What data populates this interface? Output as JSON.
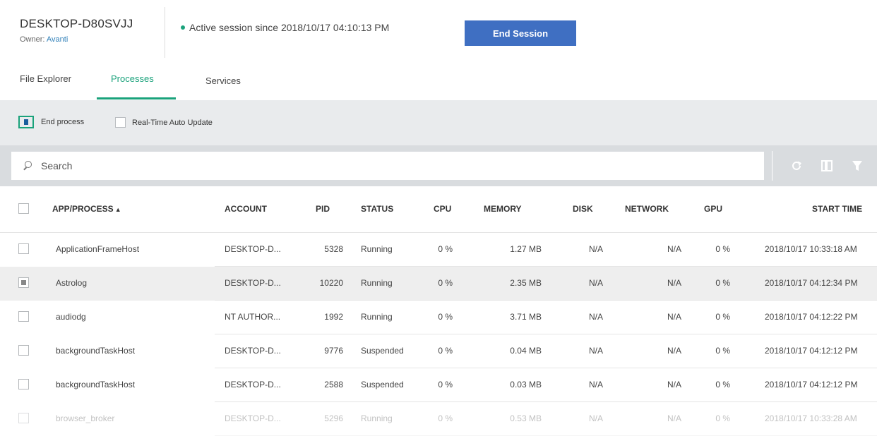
{
  "header": {
    "device_name": "DESKTOP-D80SVJJ",
    "owner_label": "Owner:",
    "owner_name": "Avanti",
    "session_text": "Active session since 2018/10/17 04:10:13 PM",
    "end_session_label": "End Session",
    "status_color": "#1aa27b",
    "accent_color": "#3f6fc2"
  },
  "tabs": [
    {
      "label": "File Explorer",
      "active": false
    },
    {
      "label": "Processes",
      "active": true
    },
    {
      "label": "Services",
      "active": false
    }
  ],
  "toolbar": {
    "end_process_label": "End process",
    "auto_update_label": "Real-Time Auto Update",
    "auto_update_checked": false
  },
  "search": {
    "placeholder": "Search",
    "icons": [
      "refresh-icon",
      "columns-icon",
      "filter-icon"
    ]
  },
  "table": {
    "columns": [
      "APP/PROCESS",
      "ACCOUNT",
      "PID",
      "STATUS",
      "CPU",
      "MEMORY",
      "DISK",
      "NETWORK",
      "GPU",
      "START TIME"
    ],
    "sort_indicator": "▲",
    "rows": [
      {
        "name": "ApplicationFrameHost",
        "account": "DESKTOP-D...",
        "pid": "5328",
        "status": "Running",
        "cpu": "0 %",
        "memory": "1.27 MB",
        "disk": "N/A",
        "network": "N/A",
        "gpu": "0 %",
        "start": "2018/10/17 10:33:18 AM",
        "selected": false
      },
      {
        "name": "Astrolog",
        "account": "DESKTOP-D...",
        "pid": "10220",
        "status": "Running",
        "cpu": "0 %",
        "memory": "2.35 MB",
        "disk": "N/A",
        "network": "N/A",
        "gpu": "0 %",
        "start": "2018/10/17 04:12:34 PM",
        "selected": true
      },
      {
        "name": "audiodg",
        "account": "NT AUTHOR...",
        "pid": "1992",
        "status": "Running",
        "cpu": "0 %",
        "memory": "3.71 MB",
        "disk": "N/A",
        "network": "N/A",
        "gpu": "0 %",
        "start": "2018/10/17 04:12:22 PM",
        "selected": false
      },
      {
        "name": "backgroundTaskHost",
        "account": "DESKTOP-D...",
        "pid": "9776",
        "status": "Suspended",
        "cpu": "0 %",
        "memory": "0.04 MB",
        "disk": "N/A",
        "network": "N/A",
        "gpu": "0 %",
        "start": "2018/10/17 04:12:12 PM",
        "selected": false
      },
      {
        "name": "backgroundTaskHost",
        "account": "DESKTOP-D...",
        "pid": "2588",
        "status": "Suspended",
        "cpu": "0 %",
        "memory": "0.03 MB",
        "disk": "N/A",
        "network": "N/A",
        "gpu": "0 %",
        "start": "2018/10/17 04:12:12 PM",
        "selected": false
      },
      {
        "name": "browser_broker",
        "account": "DESKTOP-D...",
        "pid": "5296",
        "status": "Running",
        "cpu": "0 %",
        "memory": "0.53 MB",
        "disk": "N/A",
        "network": "N/A",
        "gpu": "0 %",
        "start": "2018/10/17 10:33:28 AM",
        "selected": false
      }
    ]
  }
}
